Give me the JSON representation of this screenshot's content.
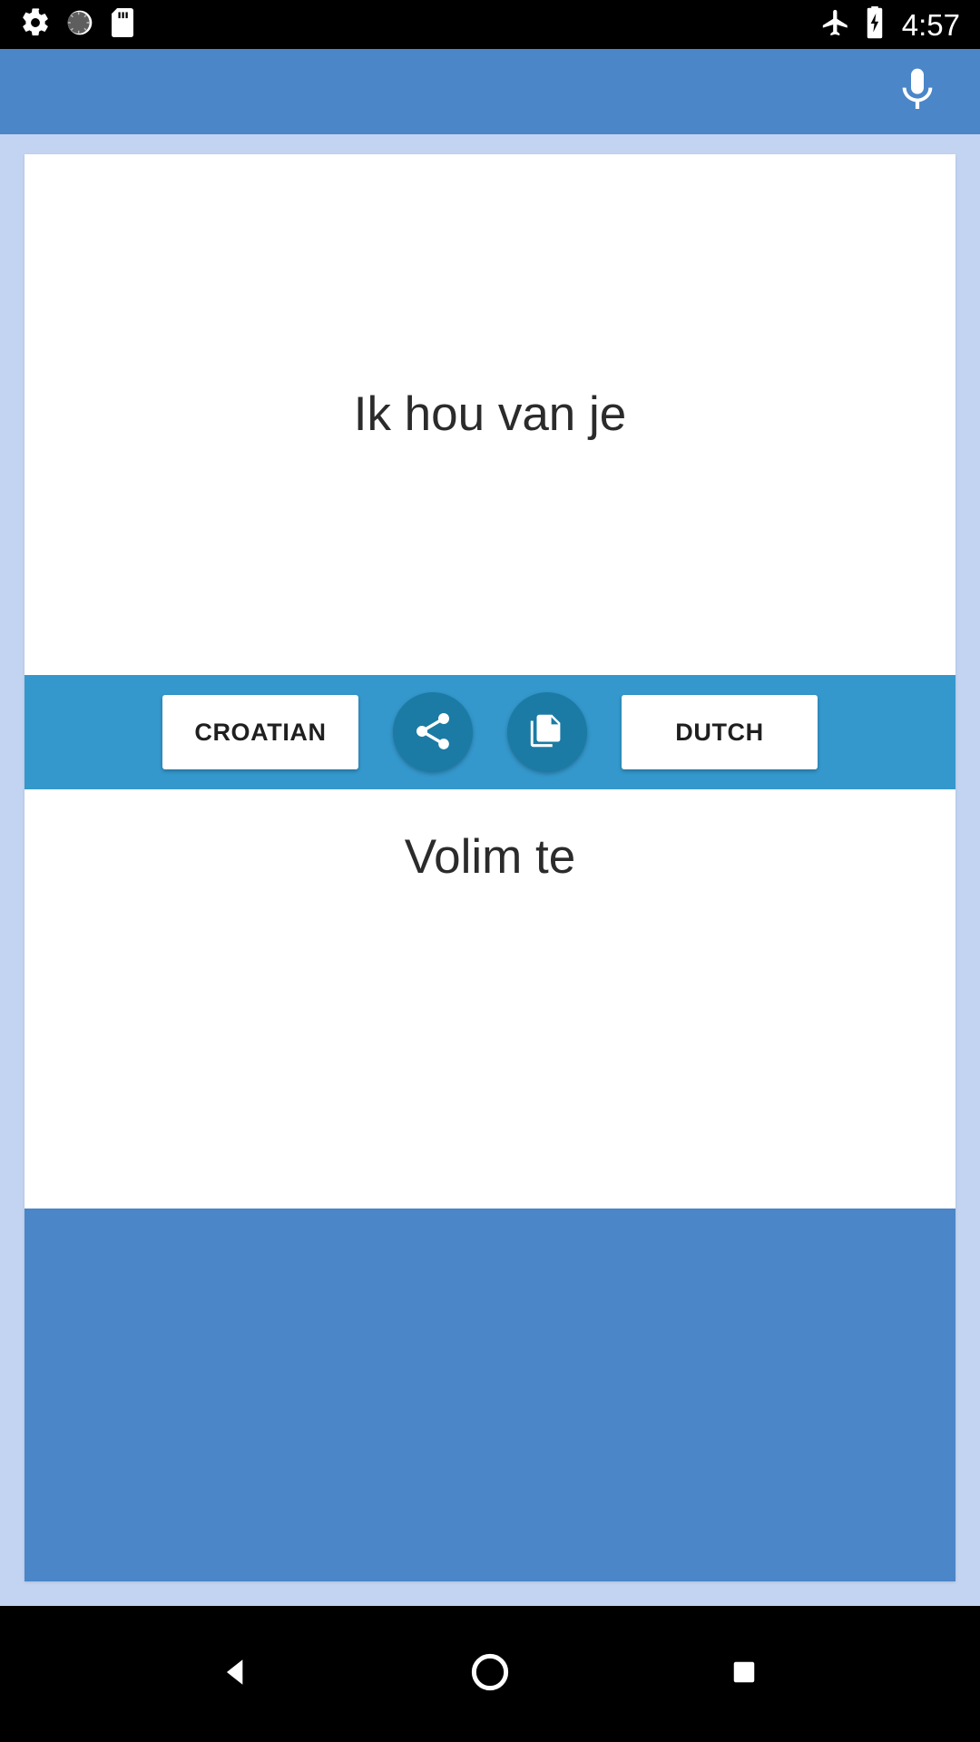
{
  "status_bar": {
    "icons_left": [
      "settings-gear-icon",
      "night-light-icon",
      "sd-card-icon"
    ],
    "icons_right": [
      "airplane-mode-icon",
      "battery-charging-icon"
    ],
    "clock": "4:57"
  },
  "app_bar": {
    "mic_icon": "microphone-icon",
    "background_color": "#4a86c8"
  },
  "translator": {
    "source_text": "Ik hou van je",
    "target_text": "Volim te",
    "source_language_label": "DUTCH",
    "target_language_label": "CROATIAN",
    "share_icon": "share-icon",
    "copy_icon": "copy-icon",
    "toolbar_color": "#3498cd",
    "round_button_color": "#1b7ba5",
    "page_background": "#c3d4f2"
  },
  "nav_bar": {
    "back": "back-triangle-icon",
    "home": "home-circle-icon",
    "recents": "recents-square-icon"
  }
}
